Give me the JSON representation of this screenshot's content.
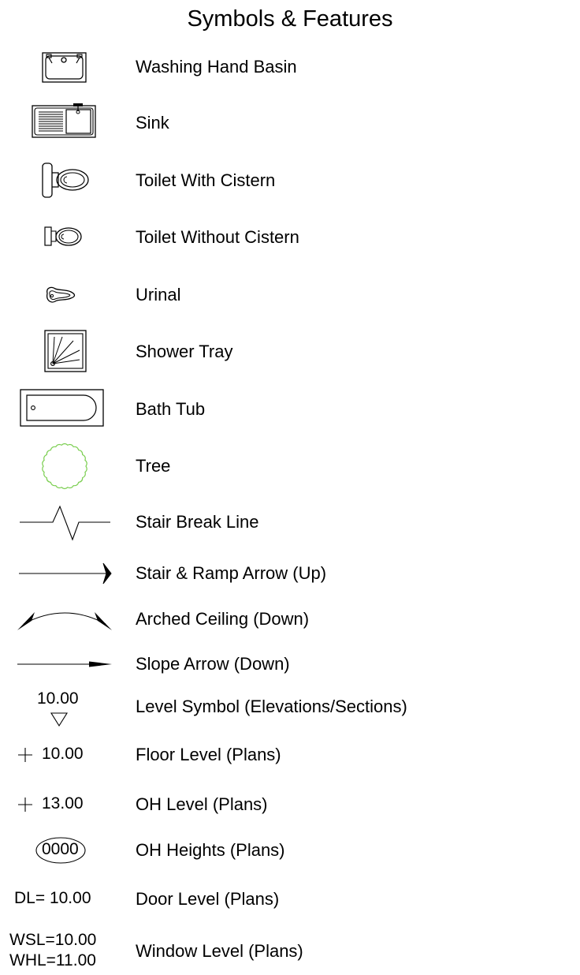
{
  "title": "Symbols & Features",
  "items": [
    {
      "label": "Washing Hand Basin",
      "icon": "washing-hand-basin-icon"
    },
    {
      "label": "Sink",
      "icon": "sink-icon"
    },
    {
      "label": "Toilet With Cistern",
      "icon": "toilet-with-cistern-icon"
    },
    {
      "label": "Toilet Without Cistern",
      "icon": "toilet-without-cistern-icon"
    },
    {
      "label": "Urinal",
      "icon": "urinal-icon"
    },
    {
      "label": "Shower Tray",
      "icon": "shower-tray-icon"
    },
    {
      "label": "Bath Tub",
      "icon": "bath-tub-icon"
    },
    {
      "label": "Tree",
      "icon": "tree-icon"
    },
    {
      "label": "Stair Break Line",
      "icon": "stair-break-line-icon"
    },
    {
      "label": "Stair & Ramp Arrow (Up)",
      "icon": "stair-ramp-arrow-icon"
    },
    {
      "label": "Arched Ceiling (Down)",
      "icon": "arched-ceiling-icon"
    },
    {
      "label": "Slope Arrow (Down)",
      "icon": "slope-arrow-icon"
    },
    {
      "label": "Level Symbol (Elevations/Sections)",
      "icon": "level-symbol-icon",
      "value": "10.00"
    },
    {
      "label": "Floor Level (Plans)",
      "icon": "plus-icon",
      "value": "10.00"
    },
    {
      "label": "OH Level (Plans)",
      "icon": "plus-icon",
      "value": "13.00"
    },
    {
      "label": "OH Heights (Plans)",
      "icon": "ellipse-icon",
      "value": "0000"
    },
    {
      "label": "Door Level (Plans)",
      "value": "DL= 10.00"
    },
    {
      "label": "Window Level (Plans)",
      "value": "WSL=10.00",
      "value2": "WHL=11.00"
    }
  ],
  "colors": {
    "line": "#000000",
    "tree": "#7ccf52"
  }
}
